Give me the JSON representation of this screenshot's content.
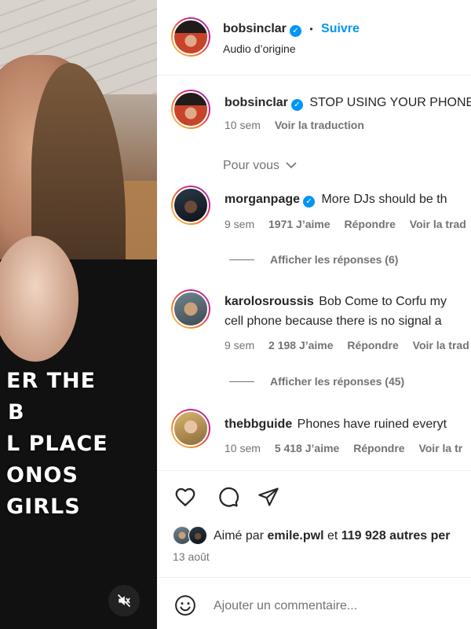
{
  "video": {
    "caption_lines": [
      "ER THE",
      "B",
      "L PLACE",
      "ONOS",
      "GIRLS"
    ]
  },
  "header": {
    "username": "bobsinclar",
    "separator": "•",
    "follow_label": "Suivre",
    "audio": "Audio d’origine"
  },
  "post": {
    "username": "bobsinclar",
    "text": "STOP USING YOUR PHONE",
    "time": "10 sem",
    "translate": "Voir la traduction"
  },
  "filter": {
    "label": "Pour vous"
  },
  "comments": [
    {
      "username": "morganpage",
      "verified": true,
      "text": "More DJs should be th",
      "time": "9 sem",
      "likes": "1971 J’aime",
      "reply": "Répondre",
      "translate": "Voir la trad",
      "show_replies": "Afficher les réponses (6)"
    },
    {
      "username": "karolosroussis",
      "verified": false,
      "text": "Bob Come to Corfu my",
      "text_line2": "cell phone because there is no signal a",
      "time": "9 sem",
      "likes": "2 198 J’aime",
      "reply": "Répondre",
      "translate": "Voir la trad",
      "show_replies": "Afficher les réponses (45)"
    },
    {
      "username": "thebbguide",
      "verified": false,
      "text": "Phones have ruined everyt",
      "time": "10 sem",
      "likes": "5 418 J’aime",
      "reply": "Répondre",
      "translate": "Voir la tr"
    }
  ],
  "likes_summary": {
    "prefix": "Aimé par",
    "user": "emile.pwl",
    "connector": "et",
    "others": "119 928 autres per"
  },
  "date": "13 août",
  "comment_box": {
    "placeholder": "Ajouter un commentaire..."
  },
  "colors": {
    "accent": "#0095f6",
    "text": "#262626",
    "muted": "#737373"
  }
}
